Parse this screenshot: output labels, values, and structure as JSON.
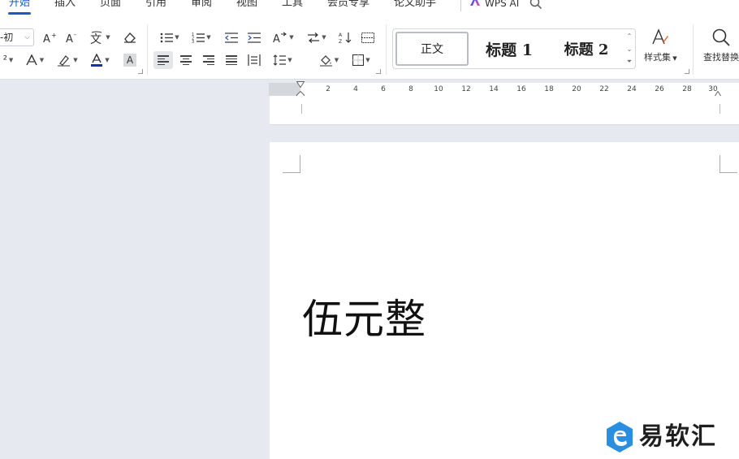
{
  "menu": {
    "tabs": [
      {
        "label": "开始",
        "active": true
      },
      {
        "label": "插入"
      },
      {
        "label": "页面"
      },
      {
        "label": "引用"
      },
      {
        "label": "审阅"
      },
      {
        "label": "视图"
      },
      {
        "label": "工具"
      },
      {
        "label": "会员专享"
      },
      {
        "label": "论文助手"
      }
    ],
    "wps_ai_label": "WPS AI"
  },
  "ribbon": {
    "font_size_value": "-初",
    "superscript_label": "²",
    "clear_style_label": "A",
    "style_gallery": {
      "items": [
        {
          "label": "正文",
          "selected": true
        },
        {
          "label": "标题 1"
        },
        {
          "label": "标题 2"
        }
      ]
    },
    "styles_set_label": "样式集",
    "find_replace_label": "查找替换"
  },
  "ruler": {
    "ticks": [
      "2",
      "4",
      "6",
      "8",
      "10",
      "12",
      "14",
      "16",
      "18",
      "20",
      "22",
      "24",
      "26",
      "28",
      "30"
    ]
  },
  "document": {
    "text": "伍元整"
  },
  "watermark": {
    "text": "易软汇"
  },
  "colors": {
    "accent": "#1f58c9",
    "font_color_bar": "#1c2fa8",
    "workspace_bg": "#e6eaf0",
    "watermark_blue": "#2a8fe0"
  }
}
